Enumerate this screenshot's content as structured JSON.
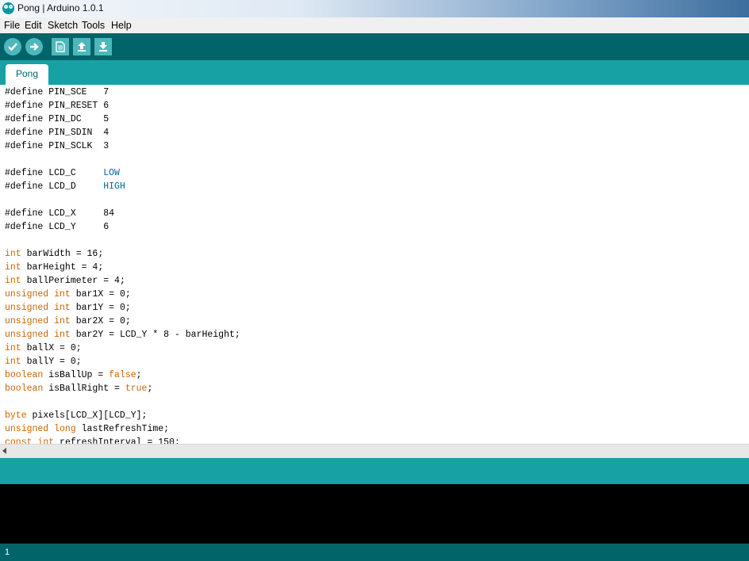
{
  "window": {
    "title": "Pong | Arduino 1.0.1"
  },
  "menu": [
    "File",
    "Edit",
    "Sketch",
    "Tools",
    "Help"
  ],
  "toolbar": {
    "buttons": [
      {
        "name": "verify",
        "icon": "checkmark-icon"
      },
      {
        "name": "upload",
        "icon": "right-arrow-icon"
      },
      {
        "name": "new",
        "icon": "document-icon"
      },
      {
        "name": "open",
        "icon": "up-arrow-icon"
      },
      {
        "name": "save",
        "icon": "down-arrow-icon"
      }
    ]
  },
  "tabs": [
    {
      "label": "Pong"
    }
  ],
  "code_lines": [
    [
      {
        "t": "#define PIN_SCE   7"
      }
    ],
    [
      {
        "t": "#define PIN_RESET 6"
      }
    ],
    [
      {
        "t": "#define PIN_DC    5"
      }
    ],
    [
      {
        "t": "#define PIN_SDIN  4"
      }
    ],
    [
      {
        "t": "#define PIN_SCLK  3"
      }
    ],
    [],
    [
      {
        "t": "#define LCD_C     "
      },
      {
        "t": "LOW",
        "c": "lit"
      }
    ],
    [
      {
        "t": "#define LCD_D     "
      },
      {
        "t": "HIGH",
        "c": "lit"
      }
    ],
    [],
    [
      {
        "t": "#define LCD_X     84"
      }
    ],
    [
      {
        "t": "#define LCD_Y     6"
      }
    ],
    [],
    [
      {
        "t": "int",
        "c": "kw"
      },
      {
        "t": " barWidth = 16;"
      }
    ],
    [
      {
        "t": "int",
        "c": "kw"
      },
      {
        "t": " barHeight = 4;"
      }
    ],
    [
      {
        "t": "int",
        "c": "kw"
      },
      {
        "t": " ballPerimeter = 4;"
      }
    ],
    [
      {
        "t": "unsigned",
        "c": "kw"
      },
      {
        "t": " "
      },
      {
        "t": "int",
        "c": "kw"
      },
      {
        "t": " bar1X = 0;"
      }
    ],
    [
      {
        "t": "unsigned",
        "c": "kw"
      },
      {
        "t": " "
      },
      {
        "t": "int",
        "c": "kw"
      },
      {
        "t": " bar1Y = 0;"
      }
    ],
    [
      {
        "t": "unsigned",
        "c": "kw"
      },
      {
        "t": " "
      },
      {
        "t": "int",
        "c": "kw"
      },
      {
        "t": " bar2X = 0;"
      }
    ],
    [
      {
        "t": "unsigned",
        "c": "kw"
      },
      {
        "t": " "
      },
      {
        "t": "int",
        "c": "kw"
      },
      {
        "t": " bar2Y = LCD_Y * 8 - barHeight;"
      }
    ],
    [
      {
        "t": "int",
        "c": "kw"
      },
      {
        "t": " ballX = 0;"
      }
    ],
    [
      {
        "t": "int",
        "c": "kw"
      },
      {
        "t": " ballY = 0;"
      }
    ],
    [
      {
        "t": "boolean",
        "c": "kw"
      },
      {
        "t": " isBallUp = "
      },
      {
        "t": "false",
        "c": "kw"
      },
      {
        "t": ";"
      }
    ],
    [
      {
        "t": "boolean",
        "c": "kw"
      },
      {
        "t": " isBallRight = "
      },
      {
        "t": "true",
        "c": "kw"
      },
      {
        "t": ";"
      }
    ],
    [],
    [
      {
        "t": "byte",
        "c": "kw"
      },
      {
        "t": " pixels[LCD_X][LCD_Y];"
      }
    ],
    [
      {
        "t": "unsigned",
        "c": "kw"
      },
      {
        "t": " "
      },
      {
        "t": "long",
        "c": "kw"
      },
      {
        "t": " lastRefreshTime;"
      }
    ],
    [
      {
        "t": "const",
        "c": "kw"
      },
      {
        "t": " "
      },
      {
        "t": "int",
        "c": "kw"
      },
      {
        "t": " refreshInterval = 150;"
      }
    ]
  ],
  "footer": {
    "line_number": "1"
  },
  "colors": {
    "toolbar": "#006468",
    "tabbar": "#17a1a5",
    "keyword": "#cc6600",
    "literal": "#006699",
    "console": "#000000"
  }
}
